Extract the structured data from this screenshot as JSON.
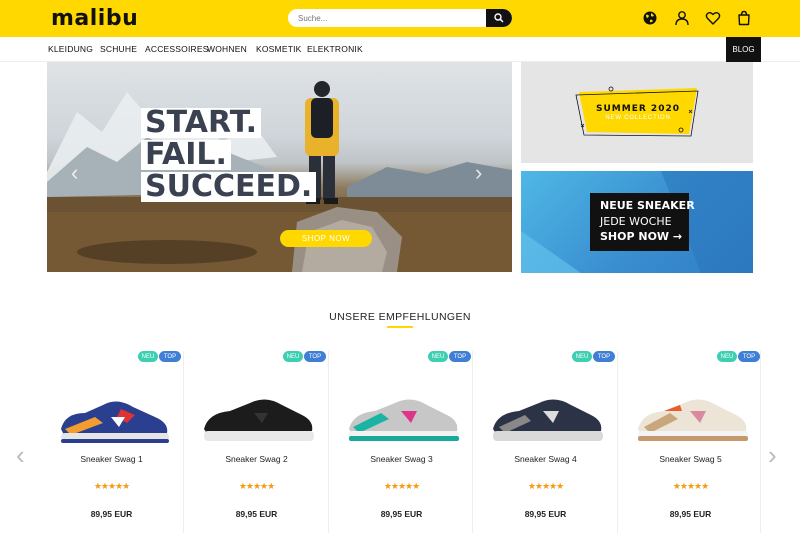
{
  "header": {
    "logo": "malibu",
    "search_placeholder": "Suche...",
    "icons": [
      "globe-icon",
      "user-icon",
      "heart-icon",
      "bag-icon"
    ]
  },
  "nav": {
    "items": [
      "KLEIDUNG",
      "SCHUHE",
      "ACCESSOIRES",
      "WOHNEN",
      "KOSMETIK",
      "ELEKTRONIK"
    ],
    "blog": "BLOG"
  },
  "hero": {
    "line1": "START.",
    "line2": "FAIL.",
    "line3": "SUCCEED.",
    "cta": "SHOP NOW"
  },
  "promo_summer": {
    "title": "SUMMER 2020",
    "subtitle": "NEW COLLECTION"
  },
  "promo_sneaker": {
    "line1": "NEUE SNEAKER",
    "line2": "JEDE WOCHE",
    "line3": "SHOP NOW →"
  },
  "recommendations": {
    "title": "UNSERE EMPFEHLUNGEN",
    "products": [
      {
        "name": "Sneaker Swag 1",
        "price": "89,95 EUR",
        "badge_new": "NEU",
        "badge_top": "TOP",
        "rating": "★★★★★"
      },
      {
        "name": "Sneaker Swag 2",
        "price": "89,95 EUR",
        "badge_new": "NEU",
        "badge_top": "TOP",
        "rating": "★★★★★"
      },
      {
        "name": "Sneaker Swag 3",
        "price": "89,95 EUR",
        "badge_new": "NEU",
        "badge_top": "TOP",
        "rating": "★★★★★"
      },
      {
        "name": "Sneaker Swag 4",
        "price": "89,95 EUR",
        "badge_new": "NEU",
        "badge_top": "TOP",
        "rating": "★★★★★"
      },
      {
        "name": "Sneaker Swag 5",
        "price": "89,95 EUR",
        "badge_new": "NEU",
        "badge_top": "TOP",
        "rating": "★★★★★"
      }
    ]
  },
  "colors": {
    "brand_yellow": "#ffd800",
    "badge_new": "#3ecfb2",
    "badge_top": "#3f7fd6",
    "star": "#f39c12"
  }
}
